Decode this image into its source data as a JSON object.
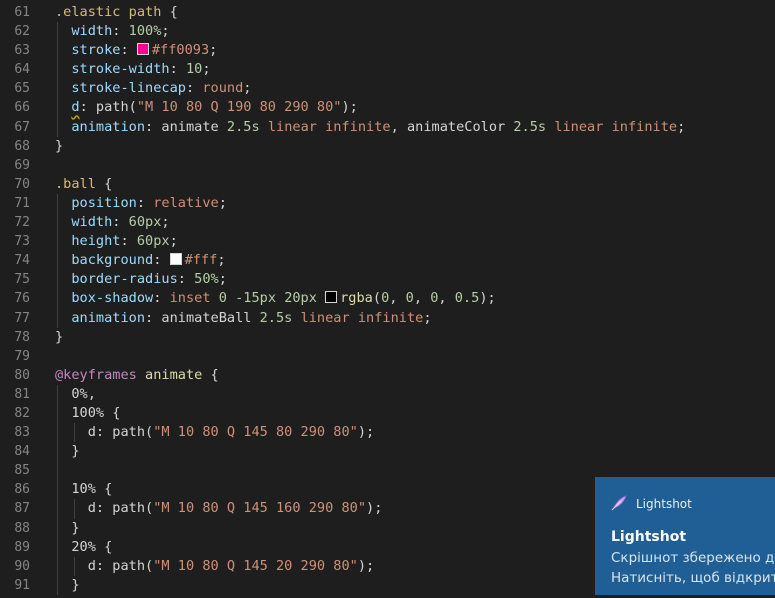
{
  "editor": {
    "lines": [
      {
        "n": "61",
        "parts": [
          [
            "sel",
            ".elastic path"
          ],
          [
            "punc",
            " {"
          ]
        ]
      },
      {
        "n": "62",
        "indent": 1,
        "parts": [
          [
            "prop",
            "width"
          ],
          [
            "punc",
            ": "
          ],
          [
            "num",
            "100%"
          ],
          [
            "punc",
            ";"
          ]
        ]
      },
      {
        "n": "63",
        "indent": 1,
        "parts": [
          [
            "prop",
            "stroke"
          ],
          [
            "punc",
            ": "
          ],
          [
            "swatch",
            "#ff0093"
          ],
          [
            "val",
            "#ff0093"
          ],
          [
            "punc",
            ";"
          ]
        ]
      },
      {
        "n": "64",
        "indent": 1,
        "parts": [
          [
            "prop",
            "stroke-width"
          ],
          [
            "punc",
            ": "
          ],
          [
            "num",
            "10"
          ],
          [
            "punc",
            ";"
          ]
        ]
      },
      {
        "n": "65",
        "indent": 1,
        "parts": [
          [
            "prop",
            "stroke-linecap"
          ],
          [
            "punc",
            ": "
          ],
          [
            "val",
            "round"
          ],
          [
            "punc",
            ";"
          ]
        ]
      },
      {
        "n": "66",
        "indent": 1,
        "parts": [
          [
            "squig",
            "d"
          ],
          [
            "punc",
            ": path("
          ],
          [
            "str",
            "\"M 10 80 Q 190 80 290 80\""
          ],
          [
            "punc",
            ");"
          ]
        ]
      },
      {
        "n": "67",
        "indent": 1,
        "parts": [
          [
            "prop",
            "animation"
          ],
          [
            "punc",
            ": animate "
          ],
          [
            "num",
            "2.5s"
          ],
          [
            "punc",
            " "
          ],
          [
            "val",
            "linear"
          ],
          [
            "punc",
            " "
          ],
          [
            "val",
            "infinite"
          ],
          [
            "punc",
            ", animateColor "
          ],
          [
            "num",
            "2.5s"
          ],
          [
            "punc",
            " "
          ],
          [
            "val",
            "linear"
          ],
          [
            "punc",
            " "
          ],
          [
            "val",
            "infinite"
          ],
          [
            "punc",
            ";"
          ]
        ]
      },
      {
        "n": "68",
        "parts": [
          [
            "punc",
            "}"
          ]
        ]
      },
      {
        "n": "69",
        "parts": []
      },
      {
        "n": "70",
        "parts": [
          [
            "sel",
            ".ball"
          ],
          [
            "punc",
            " {"
          ]
        ]
      },
      {
        "n": "71",
        "indent": 1,
        "parts": [
          [
            "prop",
            "position"
          ],
          [
            "punc",
            ": "
          ],
          [
            "val",
            "relative"
          ],
          [
            "punc",
            ";"
          ]
        ]
      },
      {
        "n": "72",
        "indent": 1,
        "parts": [
          [
            "prop",
            "width"
          ],
          [
            "punc",
            ": "
          ],
          [
            "num",
            "60px"
          ],
          [
            "punc",
            ";"
          ]
        ]
      },
      {
        "n": "73",
        "indent": 1,
        "parts": [
          [
            "prop",
            "height"
          ],
          [
            "punc",
            ": "
          ],
          [
            "num",
            "60px"
          ],
          [
            "punc",
            ";"
          ]
        ]
      },
      {
        "n": "74",
        "indent": 1,
        "parts": [
          [
            "prop",
            "background"
          ],
          [
            "punc",
            ": "
          ],
          [
            "swatch",
            "#ffffff"
          ],
          [
            "val",
            "#fff"
          ],
          [
            "punc",
            ";"
          ]
        ]
      },
      {
        "n": "75",
        "indent": 1,
        "parts": [
          [
            "prop",
            "border-radius"
          ],
          [
            "punc",
            ": "
          ],
          [
            "num",
            "50%"
          ],
          [
            "punc",
            ";"
          ]
        ]
      },
      {
        "n": "76",
        "indent": 1,
        "parts": [
          [
            "prop",
            "box-shadow"
          ],
          [
            "punc",
            ": "
          ],
          [
            "val",
            "inset"
          ],
          [
            "punc",
            " "
          ],
          [
            "num",
            "0"
          ],
          [
            "punc",
            " "
          ],
          [
            "num",
            "-15px"
          ],
          [
            "punc",
            " "
          ],
          [
            "num",
            "20px"
          ],
          [
            "punc",
            " "
          ],
          [
            "swatch",
            "#000000"
          ],
          [
            "kf",
            "rgba"
          ],
          [
            "punc",
            "("
          ],
          [
            "num",
            "0"
          ],
          [
            "punc",
            ", "
          ],
          [
            "num",
            "0"
          ],
          [
            "punc",
            ", "
          ],
          [
            "num",
            "0"
          ],
          [
            "punc",
            ", "
          ],
          [
            "num",
            "0.5"
          ],
          [
            "punc",
            ");"
          ]
        ]
      },
      {
        "n": "77",
        "indent": 1,
        "parts": [
          [
            "prop",
            "animation"
          ],
          [
            "punc",
            ": animateBall "
          ],
          [
            "num",
            "2.5s"
          ],
          [
            "punc",
            " "
          ],
          [
            "val",
            "linear"
          ],
          [
            "punc",
            " "
          ],
          [
            "val",
            "infinite"
          ],
          [
            "punc",
            ";"
          ]
        ]
      },
      {
        "n": "78",
        "parts": [
          [
            "punc",
            "}"
          ]
        ]
      },
      {
        "n": "79",
        "parts": []
      },
      {
        "n": "80",
        "parts": [
          [
            "at",
            "@keyframes"
          ],
          [
            "punc",
            " "
          ],
          [
            "kf",
            "animate"
          ],
          [
            "punc",
            " {"
          ]
        ]
      },
      {
        "n": "81",
        "indent": 1,
        "parts": [
          [
            "punc",
            "0%,"
          ]
        ]
      },
      {
        "n": "82",
        "indent": 1,
        "parts": [
          [
            "punc",
            "100% {"
          ]
        ]
      },
      {
        "n": "83",
        "indent": 2,
        "parts": [
          [
            "punc",
            "d: path("
          ],
          [
            "str",
            "\"M 10 80 Q 145 80 290 80\""
          ],
          [
            "punc",
            ");"
          ]
        ]
      },
      {
        "n": "84",
        "indent": 1,
        "parts": [
          [
            "punc",
            "}"
          ]
        ]
      },
      {
        "n": "85",
        "indent": 1,
        "parts": []
      },
      {
        "n": "86",
        "indent": 1,
        "parts": [
          [
            "punc",
            "10% {"
          ]
        ]
      },
      {
        "n": "87",
        "indent": 2,
        "parts": [
          [
            "punc",
            "d: path("
          ],
          [
            "str",
            "\"M 10 80 Q 145 160 290 80\""
          ],
          [
            "punc",
            ");"
          ]
        ]
      },
      {
        "n": "88",
        "indent": 1,
        "parts": [
          [
            "punc",
            "}"
          ]
        ]
      },
      {
        "n": "89",
        "indent": 1,
        "parts": [
          [
            "punc",
            "20% {"
          ]
        ]
      },
      {
        "n": "90",
        "indent": 2,
        "parts": [
          [
            "punc",
            "d: path("
          ],
          [
            "str",
            "\"M 10 80 Q 145 20 290 80\""
          ],
          [
            "punc",
            ");"
          ]
        ]
      },
      {
        "n": "91",
        "indent": 1,
        "parts": [
          [
            "punc",
            "}"
          ]
        ]
      }
    ]
  },
  "notification": {
    "app_name": "Lightshot",
    "title": "Lightshot",
    "message_line1": "Скрішнот збережено до",
    "message_line2": "Натисніть, щоб відкрити",
    "icon": "feather-icon",
    "background": "#1f5f95"
  }
}
